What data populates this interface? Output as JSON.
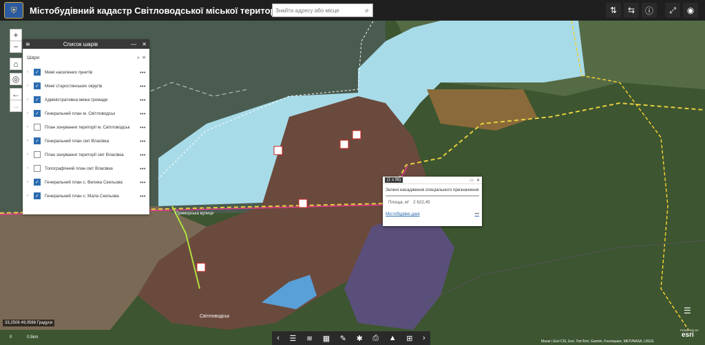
{
  "header": {
    "title": "Містобудівний кадастр Світловодської міської територіальної громади",
    "search_placeholder": "Знайти адресу або місце"
  },
  "icons": {
    "logo": "coat-of-arms-icon",
    "tools": [
      "layers-swap-icon",
      "share-icon",
      "info-icon",
      "fullscreen-icon",
      "eye-icon"
    ]
  },
  "zoom": {
    "in": "+",
    "out": "−"
  },
  "layer_panel": {
    "title": "Список шарів",
    "section_label": "Шари",
    "layers": [
      {
        "name": "Межі населених пунктів",
        "checked": true
      },
      {
        "name": "Межі старостинських округів",
        "checked": true
      },
      {
        "name": "Адміністративна межа громади",
        "checked": true
      },
      {
        "name": "Генеральний план м. Світловодськ",
        "checked": true
      },
      {
        "name": "План зонування території м. Світловодськ",
        "checked": false
      },
      {
        "name": "Генеральний план смт Власівка",
        "checked": true
      },
      {
        "name": "План зонування території смт Власівка",
        "checked": false
      },
      {
        "name": "Топографічний план смт Власівка",
        "checked": false
      },
      {
        "name": "Генеральний план с. Велика Скельова",
        "checked": true
      },
      {
        "name": "Генеральний план с. Мала Скельова",
        "checked": true
      }
    ]
  },
  "popup": {
    "counter": "(1 з 36)",
    "title": "Зелені насадження спеціального призначення",
    "area_label": "Площа, м²",
    "area_value": "2 622,45",
    "link": "Містобудівні дані"
  },
  "map_labels": [
    "Приморська вулиця",
    "Світловодськ"
  ],
  "status": {
    "coords": "33,2508 49,0566 Градуси",
    "scale_left": "0",
    "scale_right": "0,5km",
    "attribution": "Maxar | Esri CIS, Esri, TomTom, Garmin, Foursquare, METI/NASA, USGS",
    "powered": "POWERED BY",
    "esri": "esri"
  },
  "colors": {
    "water": "#a8dbe8",
    "header": "#1f1f1f",
    "accent": "#2b6cb0"
  }
}
